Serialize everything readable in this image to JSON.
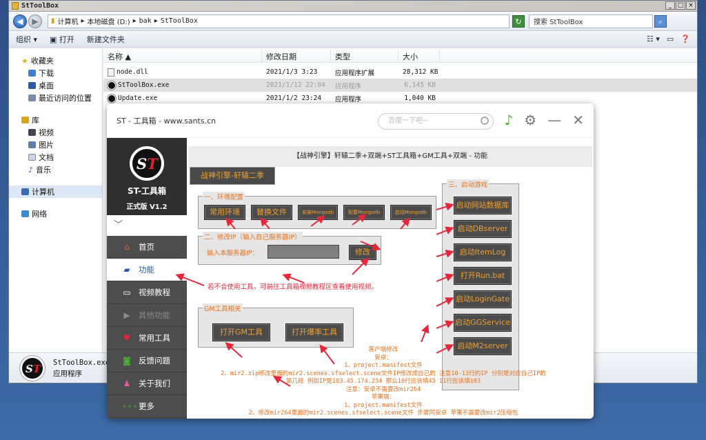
{
  "explorer": {
    "title": "StToolBox",
    "win_buttons": [
      "_",
      "□",
      "×"
    ],
    "breadcrumb": [
      "计算机",
      "本地磁盘 (D:)",
      "bak",
      "StToolBox"
    ],
    "search_placeholder": "搜索 StToolBox",
    "cmd": {
      "organize": "组织 ▾",
      "open": "打开",
      "new_folder": "新建文件夹"
    },
    "nav": {
      "favorites": "收藏夹",
      "downloads": "下载",
      "desktop": "桌面",
      "recent": "最近访问的位置",
      "libraries": "库",
      "videos": "视频",
      "pictures": "图片",
      "documents": "文档",
      "music": "音乐",
      "computer": "计算机",
      "network": "网络"
    },
    "columns": {
      "name": "名称 ▲",
      "date": "修改日期",
      "type": "类型",
      "size": "大小"
    },
    "files": [
      {
        "name": "node.dll",
        "date": "2021/1/3 3:23",
        "type": "应用程序扩展",
        "size": "28,312 KB"
      },
      {
        "name": "StToolBox.exe",
        "date": "2021/1/12 22:04",
        "type": "应用程序",
        "size": "6,145 KB"
      },
      {
        "name": "Update.exe",
        "date": "2021/1/2 23:24",
        "type": "应用程序",
        "size": "1,040 KB"
      }
    ],
    "details": {
      "name": "StToolBox.exe",
      "type": "应用程序"
    }
  },
  "app": {
    "title": "ST - 工具箱 - www.sants.cn",
    "search_placeholder": "百度一下吧~",
    "brand_name": "ST-工具箱",
    "brand_version": "正式版 V1.2",
    "collapse": "﹀",
    "menu": {
      "home": "首页",
      "features": "功能",
      "video": "视频教程",
      "other": "其他功能",
      "tools": "常用工具",
      "feedback": "反馈问题",
      "about": "关于我们",
      "more": "更多"
    },
    "heading": "【战神引擎】轩辕二季+双端+ST工具箱+GM工具+双端 - 功能",
    "tab": "战神引擎-轩辕二季",
    "env": {
      "label": "一、环境配置",
      "btn_env": "常用环境",
      "btn_replace": "替换文件",
      "btn_install_mongo": "安装Mongodb",
      "btn_config_mongo": "配置Mongodb",
      "btn_start_mongo": "启动Mongodb"
    },
    "ip": {
      "label": "二、修改IP（输入自己服务器IP）",
      "field_label": "输入本服务器IP：",
      "value": "",
      "btn": "修改"
    },
    "start": {
      "label": "三、启动游戏",
      "buttons": [
        "启动网站数据库",
        "启动DBserver",
        "启动ItemLog",
        "打开Run.bat",
        "启动LoginGate",
        "启动GGService",
        "启动M2server"
      ]
    },
    "gm": {
      "label": "GM工具相关",
      "btn_gm": "打开GM工具",
      "btn_explode": "打开爆率工具"
    },
    "hint": "若不会使用工具，可前往工具箱视频教程区查看使用视频。",
    "client_notes": [
      "客户端修改",
      "安卓：",
      "1、project.manifest文件",
      "2、mir2.zip修改里面的mir2.scenes.sfselect.scene文件IP修改成自己的  注意10-13行的IP 分别是对应自己IP的",
      "第几段 例如IP是103.45.174.234 那么10行应该填45 11行应该填103",
      "注意：安卓不需要改mir264",
      "苹果端：",
      "1、project.manifest文件",
      "2、修改mir264里面的mir2.scenes.sfselect.scene文件 步骤同安卓   苹果不需要改mir2压缩包"
    ]
  }
}
